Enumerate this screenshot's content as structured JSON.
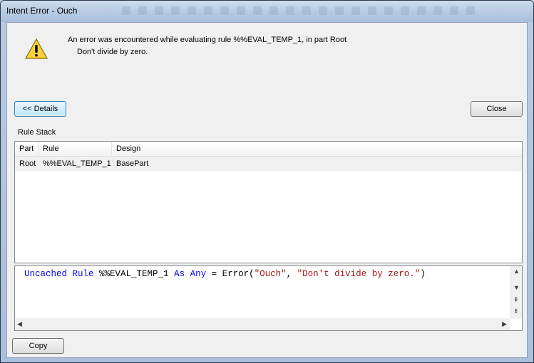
{
  "window": {
    "title": "Intent Error - Ouch"
  },
  "message": {
    "line1": "An error was encountered while evaluating rule %%EVAL_TEMP_1, in part Root",
    "line2": "Don't divide by zero."
  },
  "buttons": {
    "details": "<< Details",
    "close": "Close",
    "copy": "Copy"
  },
  "rule_stack": {
    "label": "Rule Stack",
    "columns": [
      "Part",
      "Rule",
      "Design"
    ],
    "rows": [
      [
        "Root",
        "%%EVAL_TEMP_1",
        "BasePart"
      ]
    ]
  },
  "code": {
    "tokens": [
      "Uncached",
      " ",
      "Rule",
      " %%EVAL_TEMP_1 ",
      "As",
      " ",
      "Any",
      " = Error(",
      "\"Ouch\"",
      ", ",
      "\"Don't divide by zero.\"",
      ")"
    ]
  },
  "icons": {
    "warning": "warning-icon"
  },
  "colors": {
    "keyword": "#0000ff",
    "string": "#a31515"
  }
}
